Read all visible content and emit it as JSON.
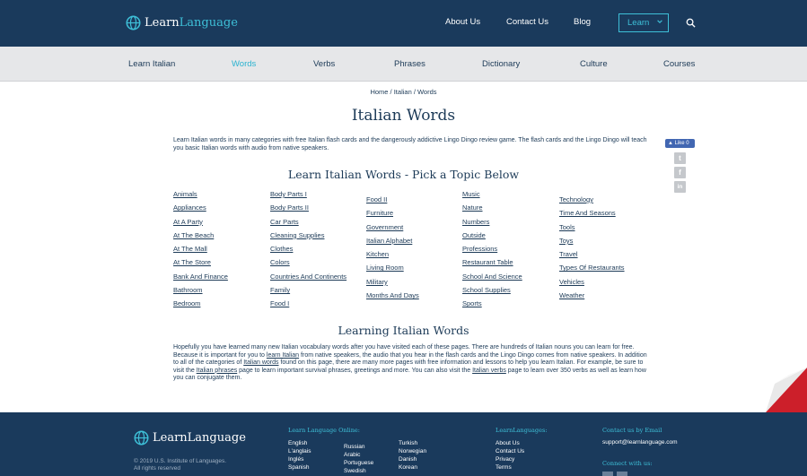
{
  "header": {
    "logo": {
      "part1": "Learn",
      "part2": "Language"
    },
    "nav": [
      "About Us",
      "Contact Us",
      "Blog"
    ],
    "learn_button": "Learn"
  },
  "subnav": {
    "items": [
      "Learn Italian",
      "Words",
      "Verbs",
      "Phrases",
      "Dictionary",
      "Culture",
      "Courses"
    ],
    "active": "Words"
  },
  "breadcrumb": "Home / Italian / Words",
  "page_title": "Italian Words",
  "intro": "Learn Italian words in many categories with free Italian flash cards and the dangerously addictive Lingo Dingo review game. The flash cards and the Lingo Dingo will teach you basic Italian words with audio from native speakers.",
  "topics_heading": "Learn Italian Words - Pick a Topic Below",
  "topics": [
    [
      "Animals",
      "Appliances",
      "At A Party",
      "At The Beach",
      "At The Mall",
      "At The Store",
      "Bank And Finance",
      "Bathroom",
      "Bedroom"
    ],
    [
      "Body Parts I",
      "Body Parts II",
      "Car Parts",
      "Cleaning Supplies",
      "Clothes",
      "Colors",
      "Countries And Continents",
      "Family",
      "Food I"
    ],
    [
      "Food II",
      "Furniture",
      "Government",
      "Italian Alphabet",
      "Kitchen",
      "Living Room",
      "Military",
      "Months And Days"
    ],
    [
      "Music",
      "Nature",
      "Numbers",
      "Outside",
      "Professions",
      "Restaurant Table",
      "School And Science",
      "School Supplies",
      "Sports"
    ],
    [
      "Technology",
      "Time And Seasons",
      "Tools",
      "Toys",
      "Travel",
      "Types Of Restaurants",
      "Vehicles",
      "Weather"
    ]
  ],
  "learning_heading": "Learning Italian Words",
  "paragraph": {
    "s1": "Hopefully you have learned many new Italian vocabulary words after you have visited each of these pages. There are hundreds of Italian nouns you can learn for free. Because it is important for you to ",
    "l1": "learn Italian",
    "s2": " from native speakers, the audio that you hear in the flash cards and the Lingo Dingo comes from native speakers. In addition to all of the categories of ",
    "l2": "Italian words",
    "s3": " found on this page, there are many more pages with free information and lessons to help you learn Italian. For example, be sure to visit the ",
    "l3": "Italian phrases",
    "s4": " page to learn important survival phrases, greetings and more. You can also visit the ",
    "l4": "Italian verbs",
    "s5": " page to learn over 350 verbs as well as learn how you can conjugate them."
  },
  "social": {
    "like": "Like 0",
    "twitter": "t",
    "facebook": "f",
    "linkedin": "in"
  },
  "footer": {
    "copyright": [
      "© 2019 U.S. Institute of Languages.",
      "All rights reserved"
    ],
    "online_heading": "Learn Language Online:",
    "languages_col1": [
      "English",
      "L'anglais",
      "Inglés",
      "Spanish"
    ],
    "languages_col2": [
      "Russian",
      "Arabic",
      "Portuguese",
      "Swedish"
    ],
    "languages_col3": [
      "Turkish",
      "Norwegian",
      "Danish",
      "Korean"
    ],
    "ll_heading": "LearnLanguages:",
    "ll_links": [
      "About Us",
      "Contact Us",
      "Privacy",
      "Terms"
    ],
    "contact_heading": "Contact us by Email",
    "email": "support@learnlanguage.com",
    "connect_heading": "Connect with us:"
  },
  "colors": {
    "navy": "#1a3a5c",
    "teal": "#3ec0d8",
    "active": "#2bb3d0",
    "subbar": "#e6e7e9"
  }
}
